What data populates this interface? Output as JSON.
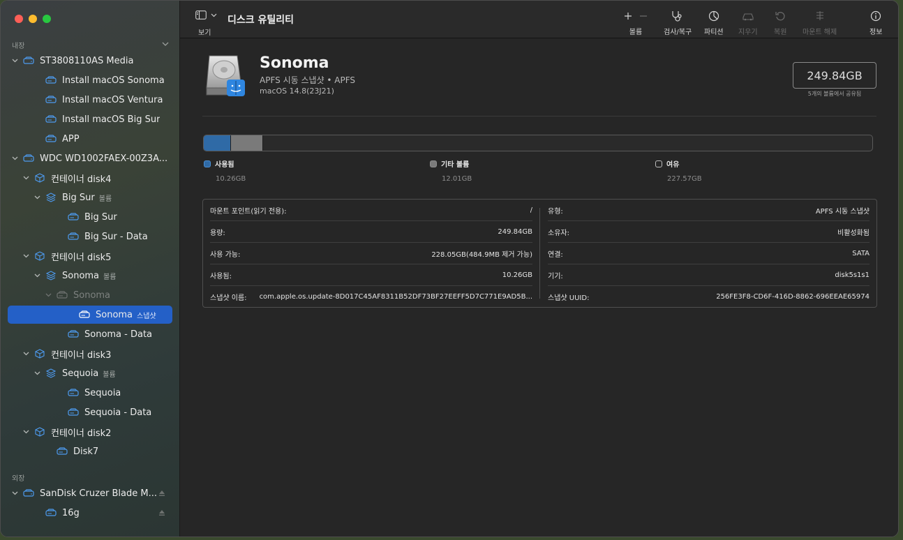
{
  "sidebar": {
    "internal_label": "내장",
    "external_label": "외장",
    "rows": [
      {
        "label": "ST3808110AS Media",
        "sub": "",
        "eject": false
      },
      {
        "label": "Install macOS Sonoma",
        "sub": "",
        "eject": false
      },
      {
        "label": "Install macOS Ventura",
        "sub": "",
        "eject": false
      },
      {
        "label": "Install macOS Big Sur",
        "sub": "",
        "eject": false
      },
      {
        "label": "APP",
        "sub": "",
        "eject": false
      },
      {
        "label": "WDC WD1002FAEX-00Z3A...",
        "sub": "",
        "eject": false
      },
      {
        "label": "컨테이너 disk4",
        "sub": "",
        "eject": false
      },
      {
        "label": "Big Sur",
        "sub": "볼륨",
        "eject": false
      },
      {
        "label": "Big Sur",
        "sub": "",
        "eject": false
      },
      {
        "label": "Big Sur - Data",
        "sub": "",
        "eject": false
      },
      {
        "label": "컨테이너 disk5",
        "sub": "",
        "eject": false
      },
      {
        "label": "Sonoma",
        "sub": "볼륨",
        "eject": false
      },
      {
        "label": "Sonoma",
        "sub": "",
        "eject": false
      },
      {
        "label": "Sonoma",
        "sub": "스냅샷",
        "eject": false
      },
      {
        "label": "Sonoma - Data",
        "sub": "",
        "eject": false
      },
      {
        "label": "컨테이너 disk3",
        "sub": "",
        "eject": false
      },
      {
        "label": "Sequoia",
        "sub": "볼륨",
        "eject": false
      },
      {
        "label": "Sequoia",
        "sub": "",
        "eject": false
      },
      {
        "label": "Sequoia - Data",
        "sub": "",
        "eject": false
      },
      {
        "label": "컨테이너 disk2",
        "sub": "",
        "eject": false
      },
      {
        "label": "Disk7",
        "sub": "",
        "eject": false
      },
      {
        "label": "SanDisk Cruzer Blade M...",
        "sub": "",
        "eject": true
      },
      {
        "label": "16g",
        "sub": "",
        "eject": true
      }
    ]
  },
  "toolbar": {
    "view_label": "보기",
    "title": "디스크 유틸리티",
    "tools": [
      {
        "label": "볼륨",
        "enabled": true,
        "icon": "plus-minus-icon"
      },
      {
        "label": "검사/복구",
        "enabled": true,
        "icon": "stethoscope-icon"
      },
      {
        "label": "파티션",
        "enabled": true,
        "icon": "pie-chart-icon"
      },
      {
        "label": "지우기",
        "enabled": false,
        "icon": "car-icon"
      },
      {
        "label": "복원",
        "enabled": false,
        "icon": "restore-icon"
      },
      {
        "label": "마운트 해제",
        "enabled": false,
        "icon": "unmount-icon"
      },
      {
        "label": "정보",
        "enabled": true,
        "icon": "info-icon"
      }
    ]
  },
  "volume": {
    "name": "Sonoma",
    "type": "APFS 시동 스냅샷 • APFS",
    "os": "macOS 14.8(23J21)",
    "capacity": "249.84GB",
    "capacity_note": "5개의 볼륨에서 공유됨"
  },
  "usage": {
    "total_gb": 249.84,
    "segments": [
      {
        "name": "사용됨",
        "value": "10.26GB",
        "gb": 10.26,
        "color": "#2f6aa6",
        "border": "#4a90d6"
      },
      {
        "name": "기타 볼륨",
        "value": "12.01GB",
        "gb": 12.01,
        "color": "#7a7a7a",
        "border": "#8d8d8d"
      },
      {
        "name": "여유",
        "value": "227.57GB",
        "gb": 227.57,
        "color": "#262626",
        "border": "#bdbdbd"
      }
    ]
  },
  "info": {
    "left": [
      {
        "key": "마운트 포인트(읽기 전용):",
        "value": "/"
      },
      {
        "key": "용량:",
        "value": "249.84GB"
      },
      {
        "key": "사용 가능:",
        "value": "228.05GB(484.9MB 제거 가능)"
      },
      {
        "key": "사용됨:",
        "value": "10.26GB"
      },
      {
        "key": "스냅샷 이름:",
        "value": "com.apple.os.update-8D017C45AF8311B52DF73BF27EEFF5D7C771E9AD5B..."
      }
    ],
    "right": [
      {
        "key": "유형:",
        "value": "APFS 시동 스냅샷"
      },
      {
        "key": "소유자:",
        "value": "비활성화됨"
      },
      {
        "key": "연결:",
        "value": "SATA"
      },
      {
        "key": "기기:",
        "value": "disk5s1s1"
      },
      {
        "key": "스냅샷 UUID:",
        "value": "256FE3F8-CD6F-416D-8862-696EEAE65974"
      }
    ]
  }
}
